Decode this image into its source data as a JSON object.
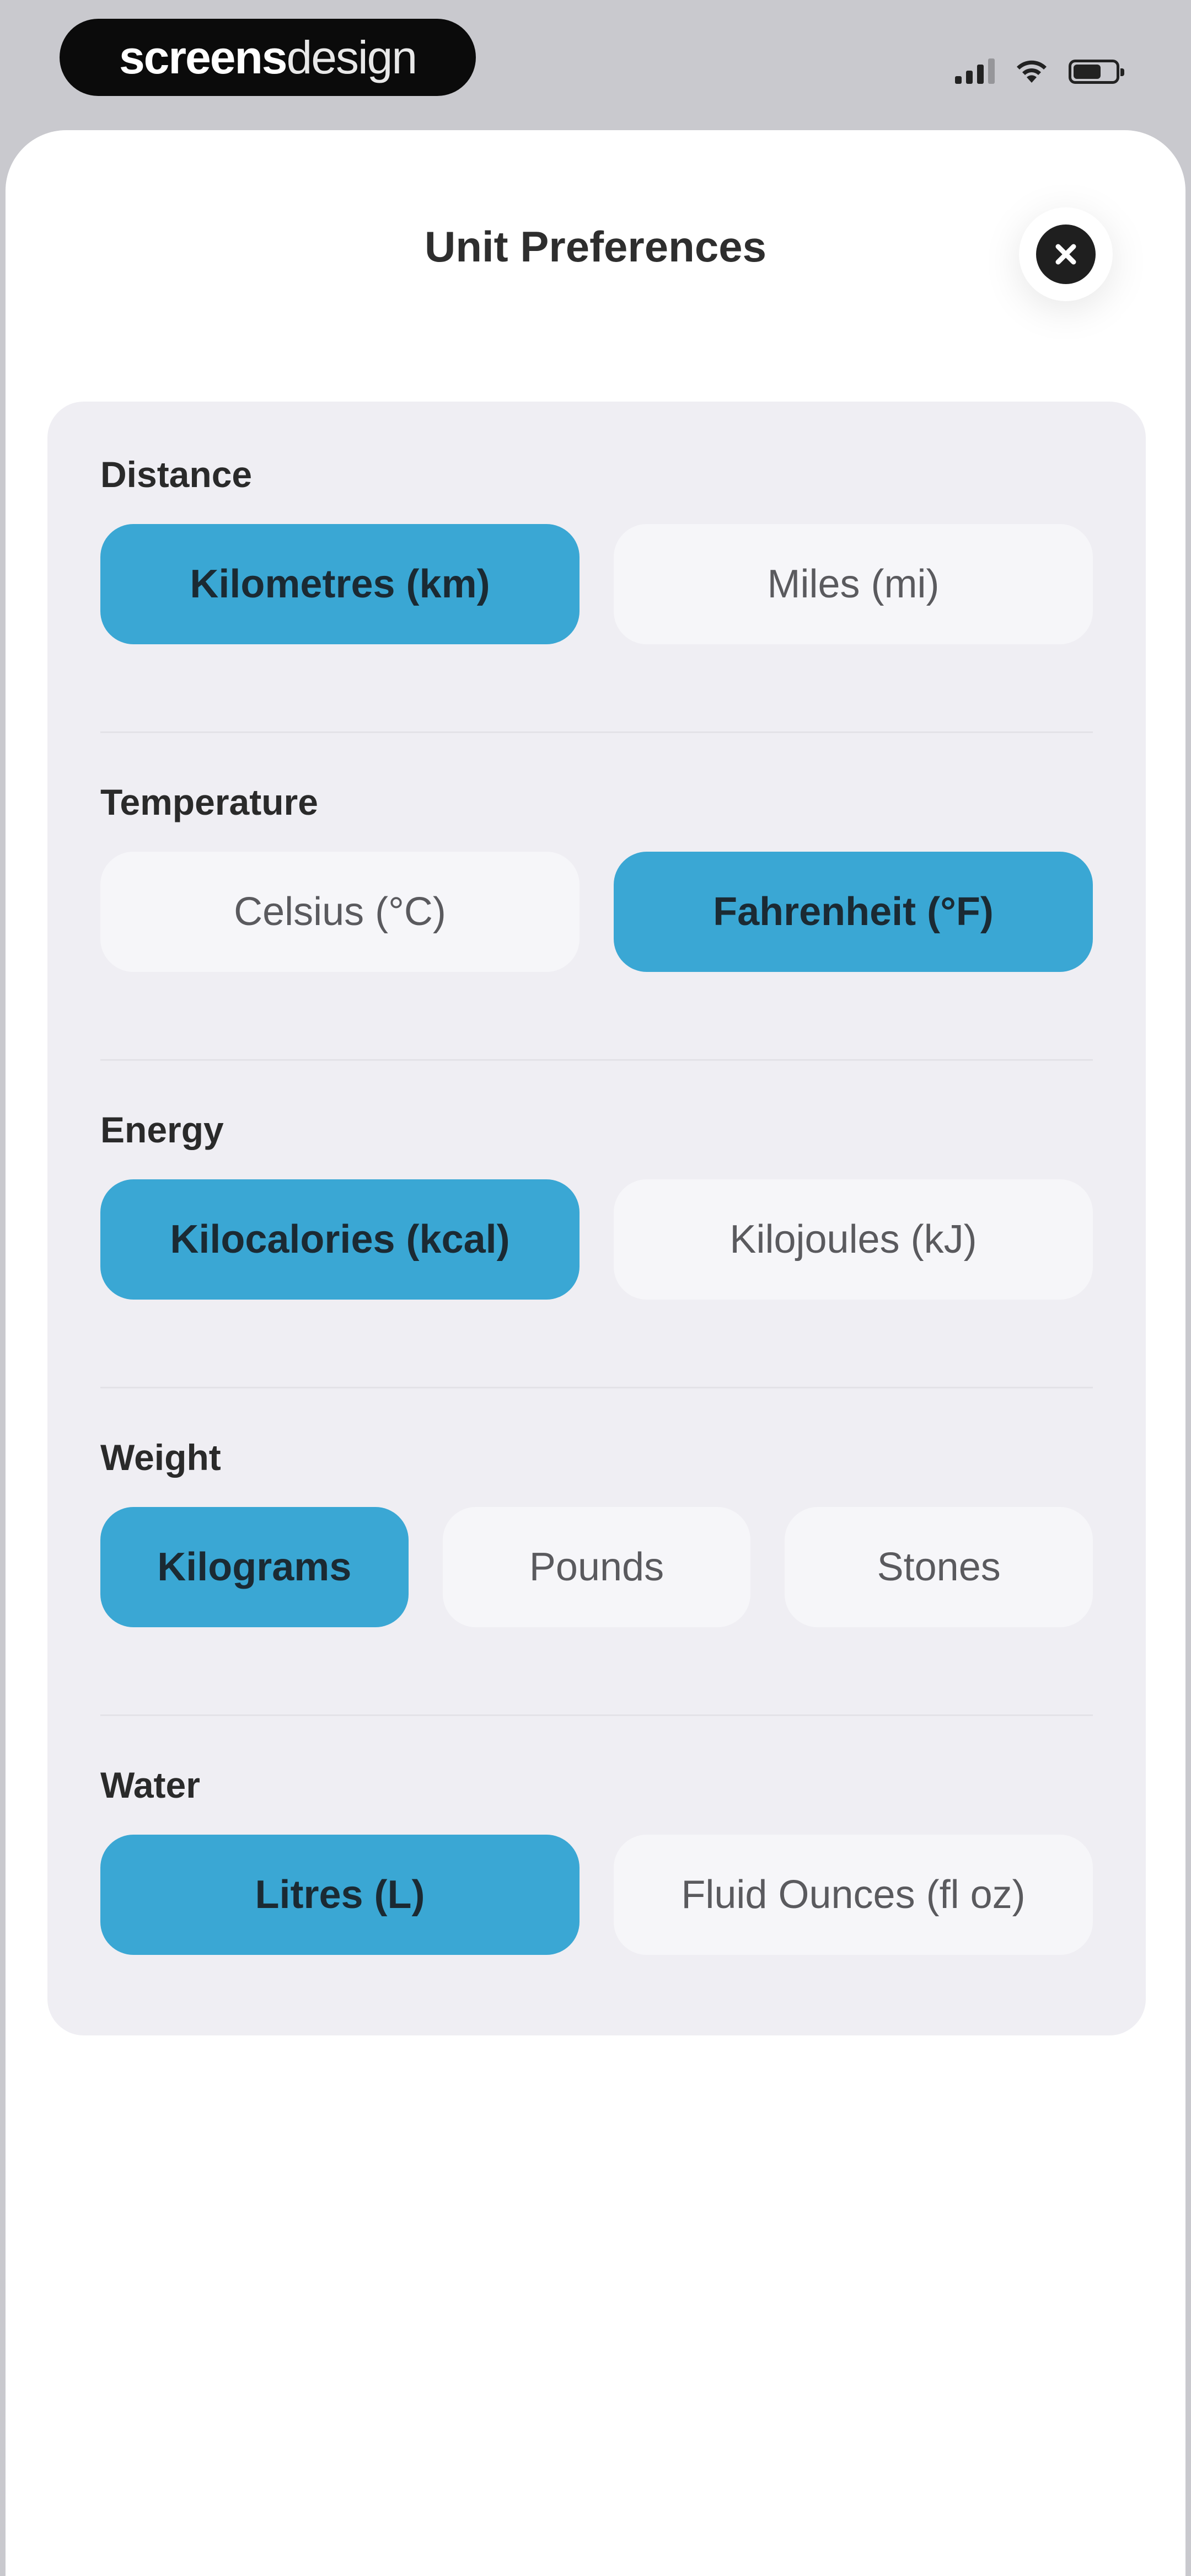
{
  "status_bar": {
    "watermark_bold": "screens",
    "watermark_light": "design"
  },
  "sheet": {
    "title": "Unit Preferences"
  },
  "sections": [
    {
      "label": "Distance",
      "options": [
        "Kilometres (km)",
        "Miles (mi)"
      ],
      "selected": "Kilometres (km)"
    },
    {
      "label": "Temperature",
      "options": [
        "Celsius (°C)",
        "Fahrenheit (°F)"
      ],
      "selected": "Fahrenheit (°F)"
    },
    {
      "label": "Energy",
      "options": [
        "Kilocalories (kcal)",
        "Kilojoules (kJ)"
      ],
      "selected": "Kilocalories (kcal)"
    },
    {
      "label": "Weight",
      "options": [
        "Kilograms",
        "Pounds",
        "Stones"
      ],
      "selected": "Kilograms"
    },
    {
      "label": "Water",
      "options": [
        "Litres (L)",
        "Fluid Ounces (fl oz)"
      ],
      "selected": "Litres (L)"
    }
  ],
  "colors": {
    "accent": "#3aa7d4",
    "card_background": "#efeef3",
    "unselected_option": "#f6f6f9"
  },
  "icons": {
    "close": "close-icon",
    "signal": "cellular-signal-icon",
    "wifi": "wifi-icon",
    "battery": "battery-icon"
  }
}
